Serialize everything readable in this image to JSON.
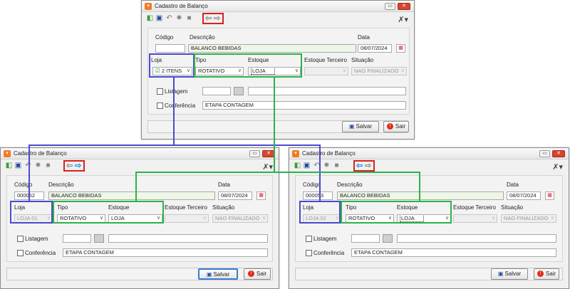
{
  "window_title": "Cadastro de Balanço",
  "labels": {
    "codigo": "Código",
    "descricao": "Descrição",
    "data": "Data",
    "loja": "Loja",
    "tipo": "Tipo",
    "estoque": "Estoque",
    "estoque_terceiro": "Estoque Terceiro",
    "situacao": "Situação",
    "listagem": "Listagem",
    "conferencia": "Conferência"
  },
  "buttons": {
    "salvar": "Salvar",
    "sair": "Sair"
  },
  "icons": {
    "toolbar": [
      "new-icon",
      "save-icon",
      "undo-icon",
      "gear-icon",
      "delete-icon",
      "arrow-left-icon",
      "arrow-right-icon"
    ],
    "tools": "tools-icon",
    "calendar": "calendar-icon",
    "exit": "exit-icon"
  },
  "colors": {
    "highlight_red": "#d92020",
    "highlight_blue": "#4a4ad0",
    "highlight_green": "#2bb34a",
    "arrow_blue": "#1a8ad6",
    "field_green": "#eef6e8"
  },
  "windows": {
    "top": {
      "codigo": "",
      "descricao": "BALANCO BEBIDAS",
      "data": "08/07/2024",
      "loja": "2 ITENS",
      "tipo": "ROTATIVO",
      "estoque": "LOJA",
      "estoque_terceiro": "",
      "situacao": "NAO FINALIZADO",
      "listagem": "",
      "conferencia": "ETAPA CONTAGEM"
    },
    "left": {
      "codigo": "000052",
      "descricao": "BALANCO BEBIDAS",
      "data": "08/07/2024",
      "loja": "LOJA 01",
      "tipo": "ROTATIVO",
      "estoque": "LOJA",
      "estoque_terceiro": "",
      "situacao": "NAO FINALIZADO",
      "listagem": "",
      "conferencia": "ETAPA CONTAGEM"
    },
    "right": {
      "codigo": "000053",
      "descricao": "BALANCO BEBIDAS",
      "data": "08/07/2024",
      "loja": "LOJA 02",
      "tipo": "ROTATIVO",
      "estoque": "LOJA",
      "estoque_terceiro": "",
      "situacao": "NAO FINALIZADO",
      "listagem": "",
      "conferencia": "ETAPA CONTAGEM"
    }
  }
}
